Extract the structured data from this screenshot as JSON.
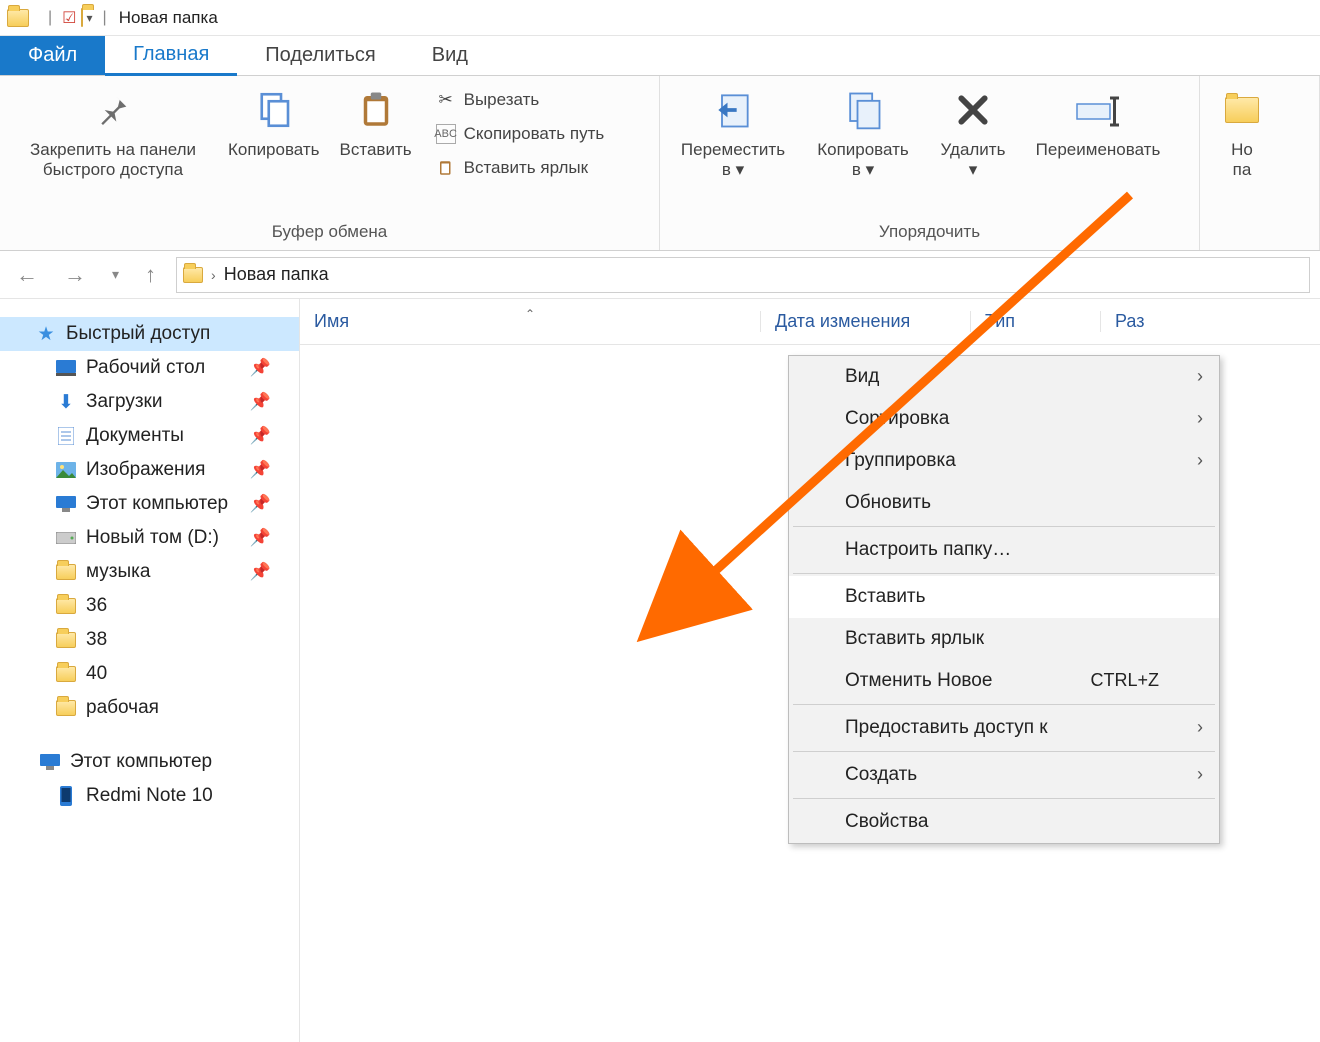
{
  "titlebar": {
    "title": "Новая папка"
  },
  "tabs": {
    "file": "Файл",
    "home": "Главная",
    "share": "Поделиться",
    "view": "Вид"
  },
  "ribbon": {
    "pin_quick": "Закрепить на панели\nбыстрого доступа",
    "copy": "Копировать",
    "paste": "Вставить",
    "cut": "Вырезать",
    "copy_path": "Скопировать путь",
    "paste_shortcut": "Вставить ярлык",
    "group_clipboard": "Буфер обмена",
    "move_to": "Переместить\nв ▾",
    "copy_to": "Копировать\nв ▾",
    "delete": "Удалить\n▾",
    "rename": "Переименовать",
    "new_folder_partial": "Но\nпа",
    "group_organize": "Упорядочить"
  },
  "breadcrumb": {
    "current": "Новая папка"
  },
  "columns": {
    "name": "Имя",
    "date": "Дата изменения",
    "type": "Тип",
    "size": "Раз"
  },
  "sidebar": {
    "quick_access": "Быстрый доступ",
    "items": [
      {
        "label": "Рабочий стол",
        "icon": "desktop",
        "pinned": true
      },
      {
        "label": "Загрузки",
        "icon": "downloads",
        "pinned": true
      },
      {
        "label": "Документы",
        "icon": "documents",
        "pinned": true
      },
      {
        "label": "Изображения",
        "icon": "pictures",
        "pinned": true
      },
      {
        "label": "Этот компьютер",
        "icon": "pc",
        "pinned": true
      },
      {
        "label": "Новый том (D:)",
        "icon": "drive",
        "pinned": true
      },
      {
        "label": "музыка",
        "icon": "folder",
        "pinned": true
      },
      {
        "label": "36",
        "icon": "folder",
        "pinned": false
      },
      {
        "label": "38",
        "icon": "folder",
        "pinned": false
      },
      {
        "label": "40",
        "icon": "folder",
        "pinned": false
      },
      {
        "label": "рабочая",
        "icon": "folder",
        "pinned": false
      }
    ],
    "this_pc": "Этот компьютер",
    "device": "Redmi Note 10"
  },
  "context_menu": {
    "view": "Вид",
    "sort": "Сортировка",
    "group": "Группировка",
    "refresh": "Обновить",
    "customize": "Настроить папку…",
    "paste": "Вставить",
    "paste_shortcut": "Вставить ярлык",
    "undo": "Отменить Новое",
    "undo_shortcut": "CTRL+Z",
    "give_access": "Предоставить доступ к",
    "new": "Создать",
    "properties": "Свойства"
  }
}
